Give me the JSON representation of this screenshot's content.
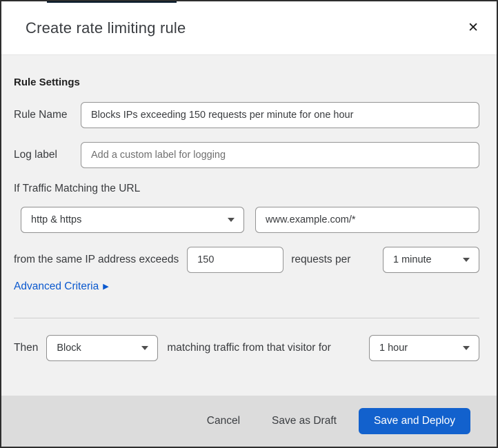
{
  "header": {
    "title": "Create rate limiting rule"
  },
  "icons": {
    "close": "✕",
    "dropdown_caret": "▾",
    "advanced_arrow": "▶"
  },
  "rule_settings": {
    "heading": "Rule Settings",
    "rule_name": {
      "label": "Rule Name",
      "value": "Blocks IPs exceeding 150 requests per minute for one hour"
    },
    "log_label": {
      "label": "Log label",
      "placeholder": "Add a custom label for logging"
    },
    "traffic": {
      "sentence": "If Traffic Matching the URL",
      "scheme_selected": "http & https",
      "url_value": "www.example.com/*"
    },
    "threshold": {
      "prefix": "from the same IP address exceeds",
      "requests_value": "150",
      "unit_text": "requests per",
      "period_selected": "1 minute"
    },
    "advanced_criteria_label": "Advanced Criteria"
  },
  "action": {
    "then_label": "Then",
    "action_selected": "Block",
    "middle_text": "matching traffic from that visitor for",
    "duration_selected": "1 hour"
  },
  "footer": {
    "cancel_label": "Cancel",
    "save_draft_label": "Save as Draft",
    "save_deploy_label": "Save and Deploy"
  },
  "colors": {
    "primary_button": "#1261cd",
    "link": "#0a58ce",
    "top_accent": "#05182a",
    "footer_background": "#dcdcdc",
    "body_background": "#f1f1f1"
  }
}
